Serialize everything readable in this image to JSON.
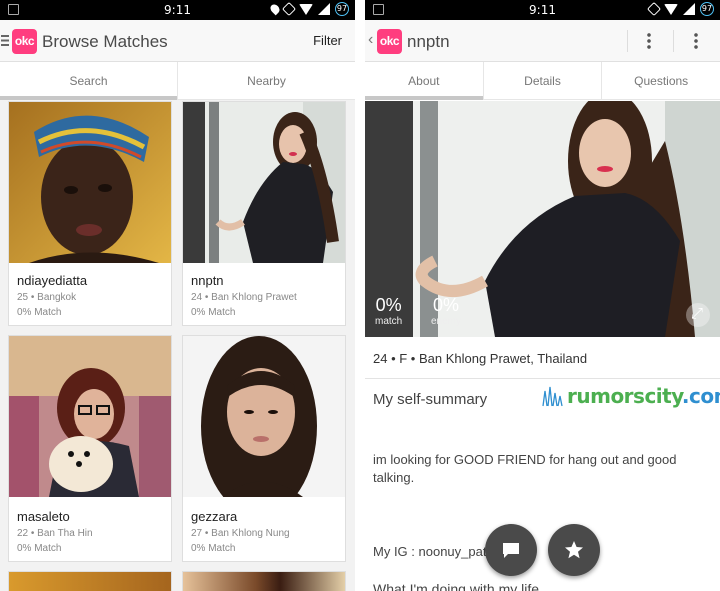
{
  "status_bar": {
    "time": "9:11",
    "battery": "97"
  },
  "left": {
    "title": "Browse Matches",
    "filter_label": "Filter",
    "logo": "okc",
    "tabs": [
      {
        "label": "Search",
        "active": true
      },
      {
        "label": "Nearby",
        "active": false
      }
    ],
    "cards": [
      {
        "name": "ndiayediatta",
        "meta": "25 • Bangkok",
        "match": "0% Match"
      },
      {
        "name": "nnptn",
        "meta": "24 • Ban Khlong Prawet",
        "match": "0% Match"
      },
      {
        "name": "masaleto",
        "meta": "22 • Ban Tha Hin",
        "match": "0% Match"
      },
      {
        "name": "gezzara",
        "meta": "27 • Ban Khlong Nung",
        "match": "0% Match"
      }
    ]
  },
  "right": {
    "title": "nnptn",
    "logo": "okc",
    "tabs": [
      {
        "label": "About",
        "active": true
      },
      {
        "label": "Details",
        "active": false
      },
      {
        "label": "Questions",
        "active": false
      }
    ],
    "match_pct": "0%",
    "match_label": "match",
    "enemy_pct": "0%",
    "enemy_label": "enemy",
    "basics": "24 • F • Ban Khlong Prawet, Thailand",
    "section_title": "My self-summary",
    "watermark": {
      "name": "rumorscity",
      "dot": ".",
      "tld": "com"
    },
    "summary": "im looking for GOOD FRIEND for hang out and good talking.",
    "ig_line": "My IG : noonuy_pat",
    "next_section": "What I'm doing with my life"
  }
}
